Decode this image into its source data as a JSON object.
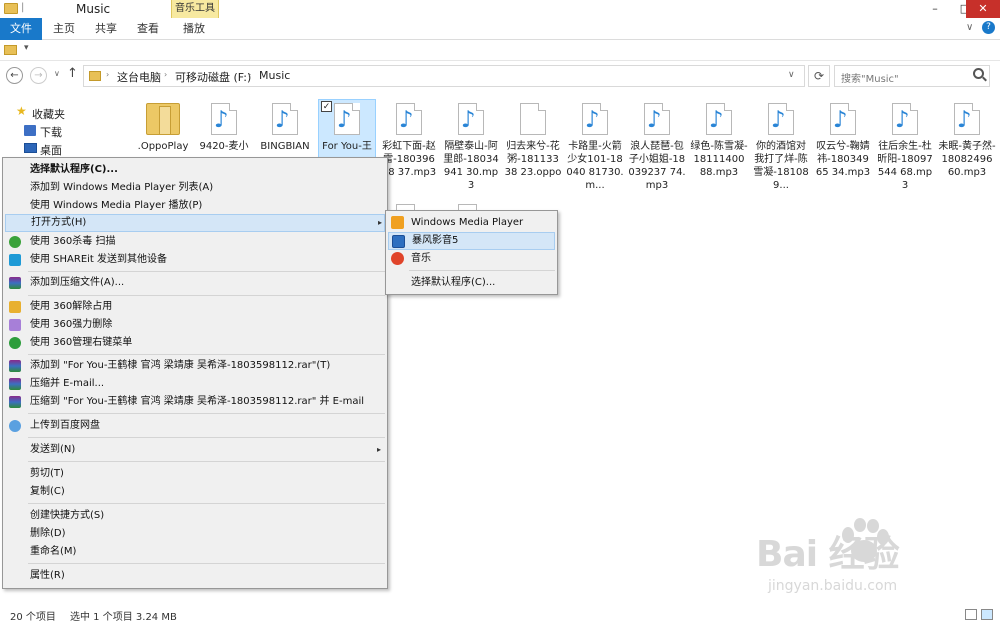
{
  "window": {
    "title": "Music",
    "contextual_tab_group": "音乐工具",
    "controls": {
      "minimize": "–",
      "maximize": "□",
      "close": "✕"
    }
  },
  "ribbon": {
    "tabs": {
      "file": "文件",
      "home": "主页",
      "share": "共享",
      "view": "查看",
      "play": "播放"
    },
    "expand": "∨",
    "help": "?"
  },
  "qat": {
    "dropdown": "▾"
  },
  "navigation": {
    "back": "←",
    "forward": "→",
    "recent": "∨",
    "up": "↑",
    "breadcrumb": [
      "这台电脑",
      "可移动磁盘 (F:)",
      "Music"
    ],
    "separator": "›",
    "address_dropdown": "∨",
    "refresh": "⟳",
    "search_placeholder": "搜索\"Music\""
  },
  "sidebar": {
    "items": [
      {
        "label": "收藏夹",
        "icon": "star-icon"
      },
      {
        "label": "下载",
        "icon": "downloads-icon"
      },
      {
        "label": "桌面",
        "icon": "desktop-icon"
      }
    ]
  },
  "files": [
    {
      "name": ".OppoPlay",
      "type": "folder"
    },
    {
      "name": "9420-麦小",
      "type": "audio"
    },
    {
      "name": "BINGBIAN",
      "type": "audio"
    },
    {
      "name": "For You-王",
      "type": "audio",
      "selected": true
    },
    {
      "name": "彩虹下面-赵雷-18039628 37.mp3",
      "type": "audio"
    },
    {
      "name": "隔壁泰山-阿里郎-18034941 30.mp3",
      "type": "audio"
    },
    {
      "name": "归去来兮-花粥-18113338 23.oppo",
      "type": "file"
    },
    {
      "name": "卡路里-火箭少女101-18040 81730.m...",
      "type": "audio"
    },
    {
      "name": "浪人琵琶-包子小姐姐-18039237 74.mp3",
      "type": "audio"
    },
    {
      "name": "绿色-陈雪凝-18111400 88.mp3",
      "type": "audio"
    },
    {
      "name": "你的酒馆对我打了烊-陈雪凝-181089...",
      "type": "audio"
    },
    {
      "name": "叹云兮-鞠婧祎-18034965 34.mp3",
      "type": "audio"
    },
    {
      "name": "往后余生-杜昕阳-18097544 68.mp3",
      "type": "audio"
    },
    {
      "name": "未眠-黄子然-18082496 60.mp3",
      "type": "audio"
    }
  ],
  "context_menu": {
    "items": [
      "选择默认程序(C)...",
      "添加到 Windows Media Player 列表(A)",
      "使用 Windows Media Player 播放(P)",
      "打开方式(H)",
      "使用 360杀毒 扫描",
      "使用 SHAREit 发送到其他设备",
      "添加到压缩文件(A)...",
      "使用 360解除占用",
      "使用 360强力删除",
      "使用 360管理右键菜单",
      "添加到 \"For You-王鹤棣  官鸿  梁靖康  吴希泽-1803598112.rar\"(T)",
      "压缩并 E-mail...",
      "压缩到 \"For You-王鹤棣  官鸿  梁靖康  吴希泽-1803598112.rar\" 并 E-mail",
      "上传到百度网盘",
      "发送到(N)",
      "剪切(T)",
      "复制(C)",
      "创建快捷方式(S)",
      "删除(D)",
      "重命名(M)",
      "属性(R)"
    ],
    "submenu_arrow": "▸"
  },
  "open_with_submenu": {
    "items": [
      {
        "label": "Windows Media Player",
        "icon": "wmp-icon"
      },
      {
        "label": "暴风影音5",
        "icon": "baofeng-icon"
      },
      {
        "label": "音乐",
        "icon": "groove-music-icon"
      },
      {
        "label": "选择默认程序(C)...",
        "icon": ""
      }
    ]
  },
  "status_bar": {
    "item_count": "20 个项目",
    "selection": "选中 1 个项目  3.24 MB"
  },
  "watermark": {
    "main": "Bai  经验",
    "sub": "jingyan.baidu.com"
  },
  "colors": {
    "accent": "#1979ca",
    "selection": "#cce8ff",
    "menu_hover": "#d4e6f7",
    "close_button": "#c7302a",
    "contextual_tab": "#f7e9a0"
  }
}
